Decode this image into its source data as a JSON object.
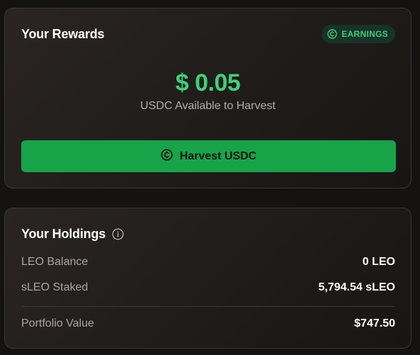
{
  "rewards": {
    "title": "Your Rewards",
    "badge_label": "EARNINGS",
    "badge_icon": "coin-icon",
    "amount": "$ 0.05",
    "amount_caption": "USDC Available to Harvest",
    "harvest_button_label": "Harvest USDC",
    "harvest_button_icon": "coin-icon"
  },
  "holdings": {
    "title": "Your Holdings",
    "title_icon": "info-icon",
    "rows": [
      {
        "label": "LEO Balance",
        "value": "0 LEO"
      },
      {
        "label": "sLEO Staked",
        "value": "5,794.54 sLEO"
      }
    ],
    "portfolio": {
      "label": "Portfolio Value",
      "value": "$747.50"
    }
  },
  "colors": {
    "accent_green": "#3fd07a",
    "button_green": "#17a449",
    "badge_bg": "#17332a"
  }
}
